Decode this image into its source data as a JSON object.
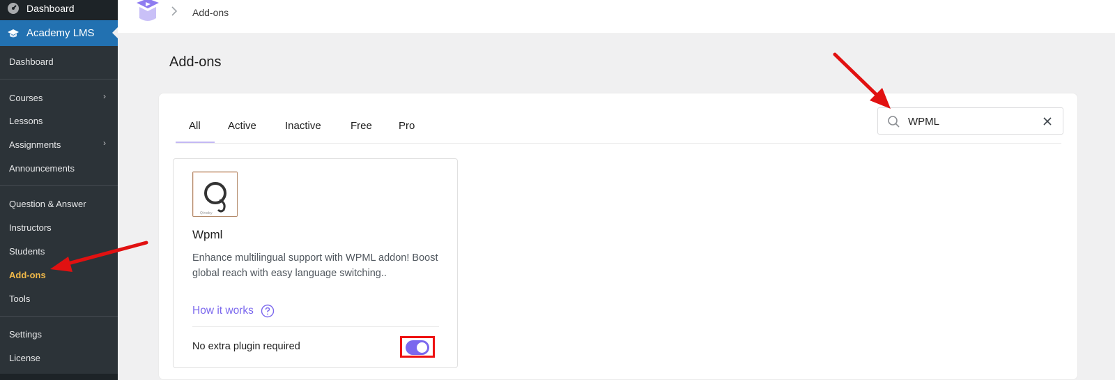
{
  "sidebar": {
    "top_items": [
      {
        "label": "Dashboard",
        "icon": "dashboard-gauge-icon"
      },
      {
        "label": "Academy LMS",
        "icon": "academy-cap-icon"
      }
    ],
    "submenu": [
      {
        "label": "Dashboard"
      },
      {
        "label": "Courses",
        "has_children": true
      },
      {
        "label": "Lessons"
      },
      {
        "label": "Assignments",
        "has_children": true
      },
      {
        "label": "Announcements"
      },
      {
        "label": "Question & Answer"
      },
      {
        "label": "Instructors"
      },
      {
        "label": "Students"
      },
      {
        "label": "Add-ons",
        "active": true
      },
      {
        "label": "Tools"
      },
      {
        "label": "Settings"
      },
      {
        "label": "License"
      }
    ]
  },
  "topbar": {
    "logo_icon": "academy-logo-icon",
    "breadcrumb": "Add-ons"
  },
  "page": {
    "title": "Add-ons"
  },
  "tabs": [
    {
      "label": "All",
      "active": true
    },
    {
      "label": "Active"
    },
    {
      "label": "Inactive"
    },
    {
      "label": "Free"
    },
    {
      "label": "Pro"
    }
  ],
  "search": {
    "value": "WPML",
    "placeholder": ""
  },
  "addon": {
    "name": "Wpml",
    "description": "Enhance multilingual support with WPML addon! Boost global reach with easy language switching..",
    "link": "How it works",
    "requirement": "No extra plugin required",
    "enabled": true,
    "thumb_icon": "wpml-logo-icon"
  },
  "colors": {
    "accent": "#7b68ee",
    "sidebar_bg": "#1d2327",
    "active_menu": "#2271b1",
    "active_submenu_text": "#f0b849",
    "annotation_red": "#e11111"
  }
}
